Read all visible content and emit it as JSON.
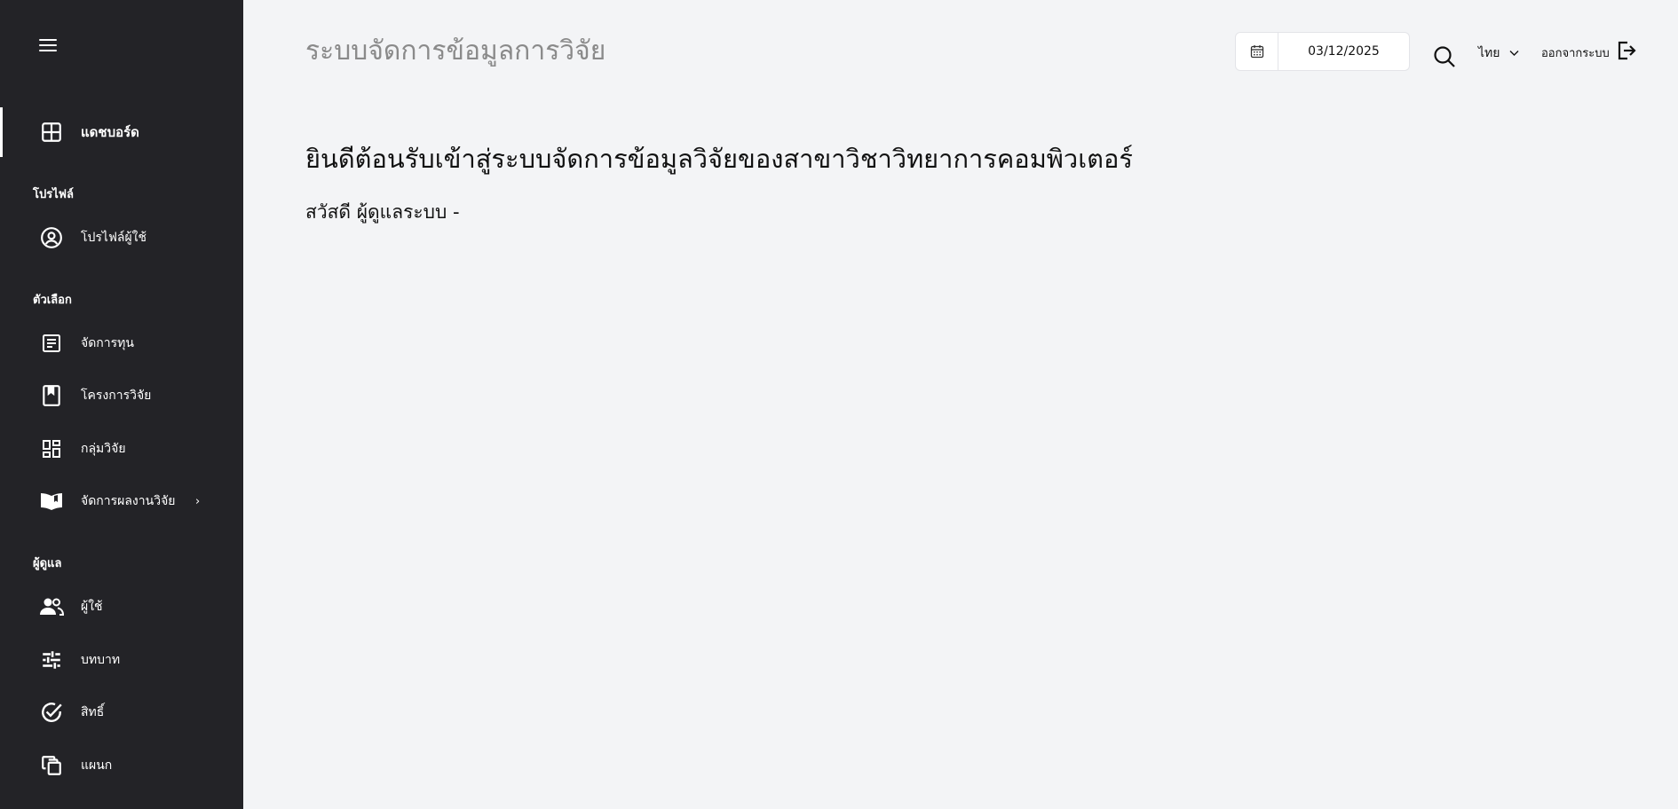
{
  "sidebar": {
    "menu_icon": "hamburger-icon",
    "dashboard": {
      "label": "แดชบอร์ด",
      "icon": "dashboard-grid-icon"
    },
    "sections": {
      "profile": "โปรไฟล์",
      "options": "ตัวเลือก",
      "admin": "ผู้ดูแล"
    },
    "items": {
      "user_profile": {
        "label": "โปรไฟล์ผู้ใช้",
        "icon": "user-circle-icon"
      },
      "manage_funds": {
        "label": "จัดการทุน",
        "icon": "document-icon"
      },
      "research_projects": {
        "label": "โครงการวิจัย",
        "icon": "bookmark-icon"
      },
      "research_groups": {
        "label": "กลุ่มวิจัย",
        "icon": "dashboard-tiles-icon"
      },
      "manage_outputs": {
        "label": "จัดการผลงานวิจัย",
        "icon": "open-book-icon",
        "chevron": "›"
      },
      "users": {
        "label": "ผู้ใช้",
        "icon": "users-icon"
      },
      "roles": {
        "label": "บทบาท",
        "icon": "sliders-icon"
      },
      "permissions": {
        "label": "สิทธิ์",
        "icon": "check-circle-icon"
      },
      "departments": {
        "label": "แผนก",
        "icon": "copy-icon"
      }
    }
  },
  "header": {
    "title": "ระบบจัดการข้อมูลการวิจัย",
    "date": "03/12/2025",
    "language": "ไทย",
    "logout": "ออกจากระบบ"
  },
  "content": {
    "welcome": "ยินดีต้อนรับเข้าสู่ระบบจัดการข้อมูลวิจัยของสาขาวิชาวิทยาการคอมพิวเตอร์",
    "greeting": "สวัสดี ผู้ดูแลระบบ -"
  },
  "colors": {
    "sidebar_bg": "#232327",
    "main_bg": "#f3f4f6",
    "title_gray": "#8a8a8a"
  }
}
